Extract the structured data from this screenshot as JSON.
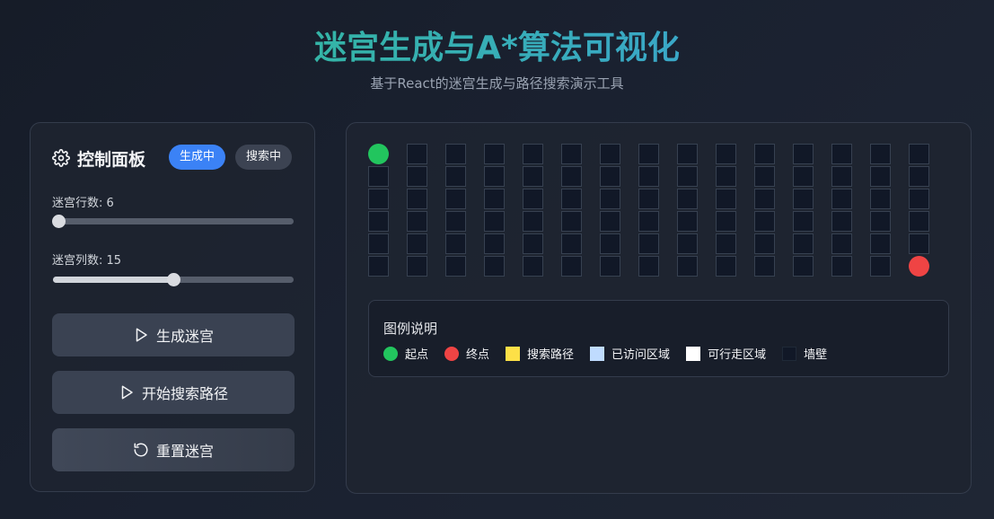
{
  "header": {
    "title": "迷宫生成与A*算法可视化",
    "subtitle": "基于React的迷宫生成与路径搜索演示工具"
  },
  "control_panel": {
    "icon": "gear-icon",
    "title": "控制面板",
    "badges": {
      "generating": "生成中",
      "searching": "搜索中"
    },
    "rows_slider": {
      "label": "迷宫行数: 6",
      "value": 6,
      "min": 5,
      "max": 50
    },
    "cols_slider": {
      "label": "迷宫列数: 15",
      "value": 15,
      "min": 5,
      "max": 25
    },
    "buttons": {
      "generate": "生成迷宫",
      "search": "开始搜索路径",
      "reset": "重置迷宫"
    }
  },
  "maze": {
    "rows": 6,
    "cols": 15,
    "start": [
      0,
      0
    ],
    "end": [
      5,
      14
    ],
    "cell_state": "wall"
  },
  "legend": {
    "title": "图例说明",
    "items": [
      {
        "label": "起点",
        "color": "#22c55e",
        "shape": "circle"
      },
      {
        "label": "终点",
        "color": "#ef4444",
        "shape": "circle"
      },
      {
        "label": "搜索路径",
        "color": "#fde047",
        "shape": "square"
      },
      {
        "label": "已访问区域",
        "color": "#bfdbfe",
        "shape": "square"
      },
      {
        "label": "可行走区域",
        "color": "#ffffff",
        "shape": "square"
      },
      {
        "label": "墙壁",
        "color": "#111827",
        "shape": "square"
      }
    ]
  },
  "colors": {
    "accent_blue": "#3b82f6",
    "start_green": "#22c55e",
    "end_red": "#ef4444"
  }
}
